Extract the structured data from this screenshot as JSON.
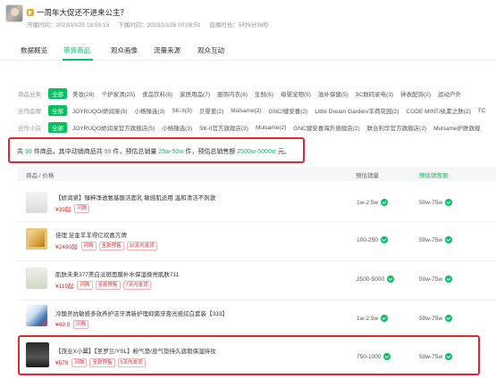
{
  "live": {
    "title": "一周年大促还不进来公主？",
    "start_time": "开播时间：2023/10/25 18:59:15",
    "end_time": "下播时间：2023/10/26 00:08:51",
    "duration": "直播时长：5时9分36秒"
  },
  "tabs": [
    "数据概览",
    "带货商品",
    "观众画像",
    "流量来源",
    "观众互动"
  ],
  "filters": {
    "all_label": "全部",
    "rows": [
      {
        "label": "商品分类",
        "options": [
          "美妆(28)",
          "个护家清(25)",
          "食品饮料(8)",
          "家居用品(7)",
          "服饰内衣(6)",
          "生鲜(6)",
          "母婴宠物(5)",
          "滋补保健(5)",
          "3C数码家电(3)",
          "钟表配饰(2)",
          "运动户外"
        ]
      },
      {
        "label": "合作品牌",
        "options": [
          "JOYRUQO/娇润泉(5)",
          "小杨臻选(3)",
          "SK-II(3)",
          "贝婴爱(2)",
          "Mulsame(2)",
          "GNC/健安喜(2)",
          "Little Dream Garden/丰荷花园(2)",
          "CODE MINT/纨素之肤(2)",
          "TC"
        ]
      },
      {
        "label": "合作小店",
        "options": [
          "JOYRUQO娇润泉官方旗舰店(5)",
          "小杨臻选(3)",
          "SK-II官方旗舰店(3)",
          "Mulsame(2)",
          "GNC健安喜海外旗舰店(2)",
          "联合利华官方旗舰店(2)",
          "Mulsame护肤旗舰"
        ]
      }
    ]
  },
  "summary": {
    "prefix": "共",
    "total_count": "99",
    "mid1": "件商品，其中动销商品共",
    "sold_count": "99",
    "mid2": "件，预估总销量",
    "sales_range": "25w-50w",
    "mid3": "件，预估总销售额",
    "revenue_range": "2500w-5000w",
    "suffix": "元。"
  },
  "table": {
    "headers": {
      "product": "商品 / 价格",
      "sales": "预估销量",
      "revenue": "预估销售额"
    },
    "rows": [
      {
        "name": "【娇润泉】臻粹净透氨基酸洁面乳 敏感肌适用 温和清洁不刺激",
        "price": "¥39起",
        "tags": [
          "闪购"
        ],
        "sales": "1w-2.5w",
        "revenue": "50w-75w"
      },
      {
        "name": "佳理 足金羊羊得亿欢喜方牌",
        "price": "¥2490起",
        "tags": [
          "闪购",
          "全款预售",
          "10天内发货"
        ],
        "sales": "100-250",
        "revenue": "50w-75w"
      },
      {
        "name": "肌肤未来377美白淡斑面膜补水保湿焕亮肌肤711",
        "price": "¥119起",
        "tags": [
          "闪购",
          "全款预售",
          "7天内发货"
        ],
        "sales": "2500-5000",
        "revenue": "50w-75w"
      },
      {
        "name": "冷酸灵抗敏感多效养护洁牙清新护理抑菌牙膏光感炫白套装【333】",
        "price": "¥49.9",
        "tags": [
          "闪购"
        ],
        "sales": "1w-2.5w",
        "revenue": "50w-75w"
      },
      {
        "name": "【茂业X小翼】【圣罗兰/YSL】粉气垫/皮气垫持久遮瑕保湿持妆",
        "price": "¥578",
        "tags": [
          "闪购",
          "全款预售",
          "5天内发货"
        ],
        "sales": "750-1000",
        "revenue": "50w-75w"
      }
    ]
  },
  "colors": {
    "accent": "#07c160",
    "alert": "#e0292f"
  }
}
